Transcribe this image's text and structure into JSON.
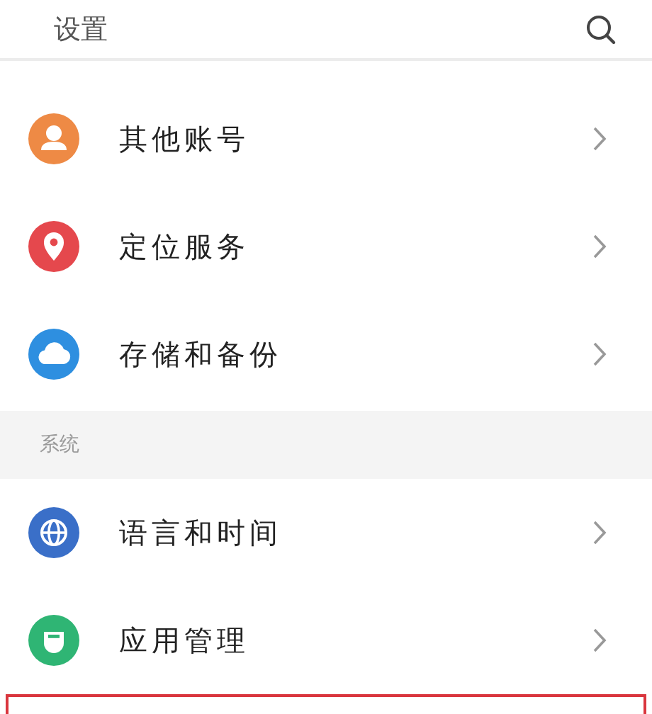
{
  "header": {
    "title": "设置"
  },
  "groups": [
    {
      "items": [
        {
          "label": "其他账号",
          "color": "#ee8a45"
        },
        {
          "label": "定位服务",
          "color": "#e5484d"
        },
        {
          "label": "存储和备份",
          "color": "#2e8fe0"
        }
      ]
    },
    {
      "title": "系统",
      "items": [
        {
          "label": "语言和时间",
          "color": "#3a6fc8"
        },
        {
          "label": "应用管理",
          "color": "#2fb574"
        }
      ]
    }
  ]
}
